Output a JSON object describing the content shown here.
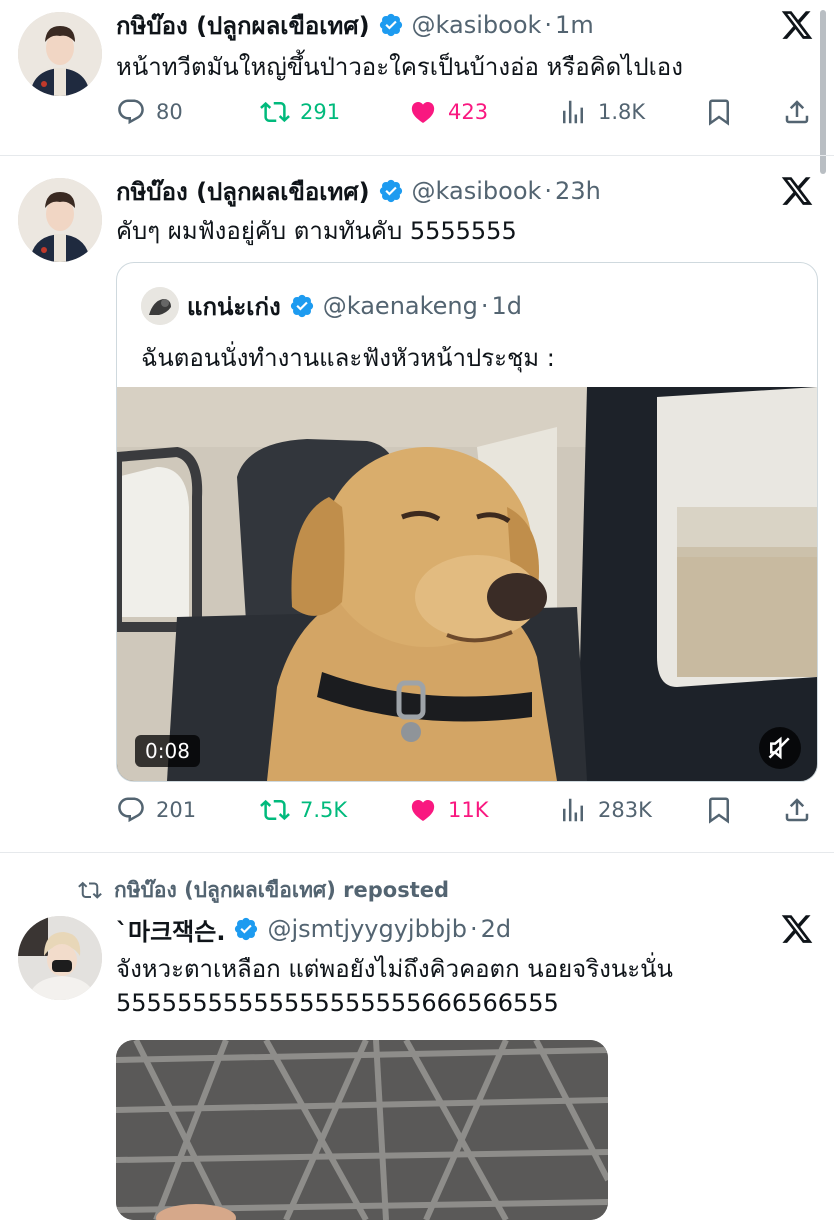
{
  "tweets": [
    {
      "author_name": "กษิบ๊อง (ปลูกผลเขือเทศ)",
      "handle": "@kasibook",
      "time": "1m",
      "text": "หน้าทวีตมันใหญ่ขึ้นป่าวอะใครเป็นบ้างอ่อ หรือคิดไปเอง",
      "replies": "80",
      "reposts": "291",
      "likes": "423",
      "views": "1.8K"
    },
    {
      "author_name": "กษิบ๊อง (ปลูกผลเขือเทศ)",
      "handle": "@kasibook",
      "time": "23h",
      "text": "คับๆ ผมฟังอยู่คับ ตามทันคับ 5555555",
      "quote": {
        "author_name": "แกน่ะเก่ง",
        "handle": "@kaenakeng",
        "time": "1d",
        "text": "ฉันตอนนั่งทำงานและฟังหัวหน้าประชุม :",
        "video_duration": "0:08"
      },
      "replies": "201",
      "reposts": "7.5K",
      "likes": "11K",
      "views": "283K"
    },
    {
      "repost_context": "กษิบ๊อง (ปลูกผลเขือเทศ) reposted",
      "author_name": "`마크잭슨.",
      "handle": "@jsmtjyygyjbbjb",
      "time": "2d",
      "text_line1": "จังหวะตาเหลือก แต่พอยังไม่ถึงคิวคอตก นอยจริงนะนั่น",
      "text_line2": "55555555555555555555666566555"
    }
  ],
  "colors": {
    "verified": "#1d9bf0",
    "repost_green": "#00ba7c",
    "like_pink": "#f91880",
    "secondary_text": "#536471"
  },
  "icons": [
    "reply-icon",
    "repost-icon",
    "like-icon",
    "views-icon",
    "bookmark-icon",
    "share-icon",
    "x-logo-icon",
    "verified-badge-icon",
    "mute-icon"
  ]
}
